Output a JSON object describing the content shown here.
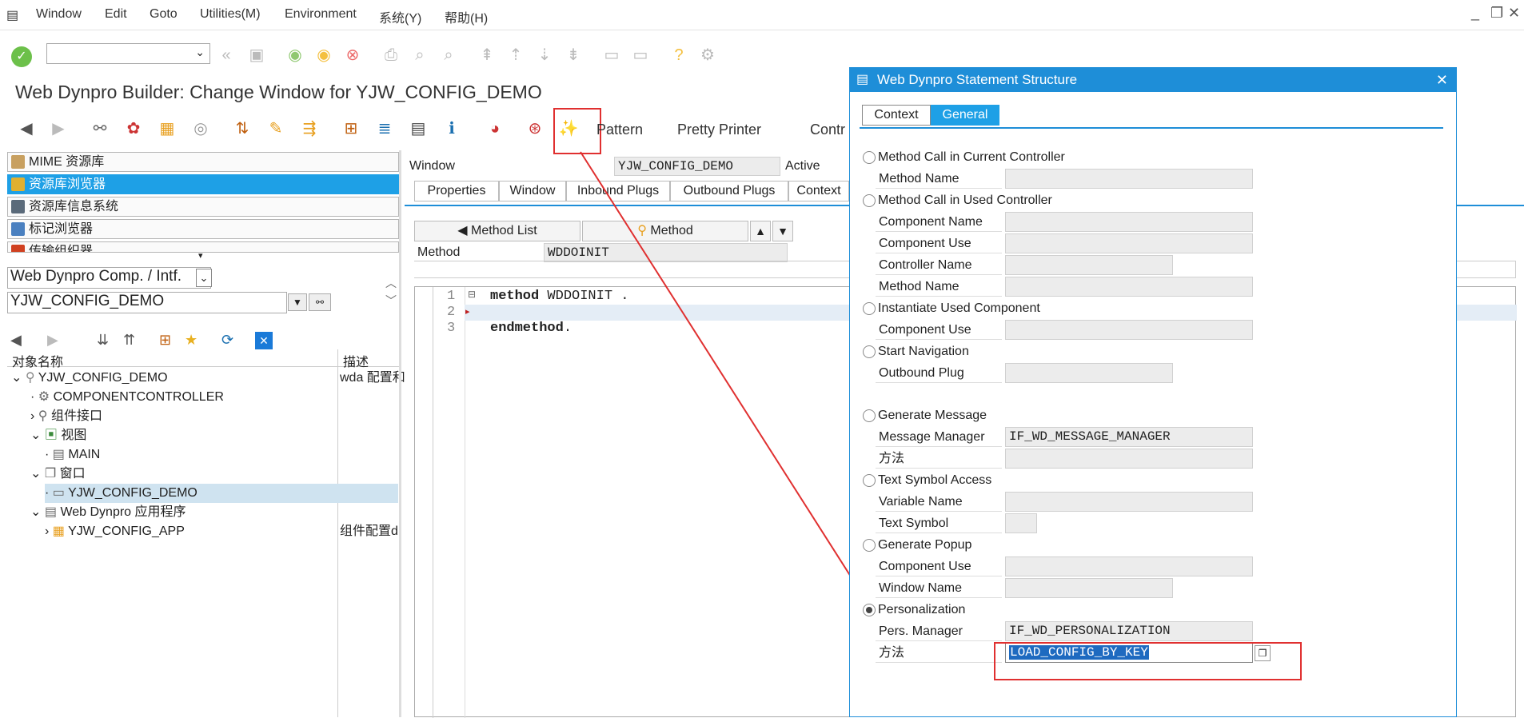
{
  "menubar": {
    "items": [
      "Window",
      "Edit",
      "Goto",
      "Utilities(M)",
      "Environment",
      "系统(Y)",
      "帮助(H)"
    ]
  },
  "title": "Web Dynpro Builder: Change Window for YJW_CONFIG_DEMO",
  "toolbar2": {
    "pattern": "Pattern",
    "pretty_printer": "Pretty Printer",
    "contr": "Contr"
  },
  "left": {
    "items": [
      "MIME 资源库",
      "资源库浏览器",
      "资源库信息系统",
      "标记浏览器",
      "传输组织器"
    ],
    "object_type": "Web Dynpro Comp. / Intf.",
    "object_name": "YJW_CONFIG_DEMO",
    "col_name": "对象名称",
    "col_desc": "描述",
    "tree": [
      {
        "label": "YJW_CONFIG_DEMO",
        "desc": "wda 配置和"
      },
      {
        "label": "COMPONENTCONTROLLER",
        "desc": ""
      },
      {
        "label": "组件接口",
        "desc": ""
      },
      {
        "label": "视图",
        "desc": ""
      },
      {
        "label": "MAIN",
        "desc": ""
      },
      {
        "label": "窗口",
        "desc": ""
      },
      {
        "label": "YJW_CONFIG_DEMO",
        "desc": ""
      },
      {
        "label": "Web Dynpro 应用程序",
        "desc": ""
      },
      {
        "label": "YJW_CONFIG_APP",
        "desc": "组件配置d"
      }
    ]
  },
  "window_header": {
    "window_label": "Window",
    "window_value": "YJW_CONFIG_DEMO",
    "status": "Active"
  },
  "tabs": [
    "Properties",
    "Window",
    "Inbound Plugs",
    "Outbound Plugs",
    "Context"
  ],
  "method_bar": {
    "method_list": "Method List",
    "method": "Method",
    "method_label": "Method",
    "method_value": "WDDOINIT"
  },
  "code": {
    "line_numbers": [
      "1",
      "2",
      "3"
    ],
    "line1_kw": "method",
    "line1_rest": " WDDOINIT .",
    "line3_kw": "endmethod",
    "line3_rest": "."
  },
  "dialog": {
    "title": "Web Dynpro Statement Structure",
    "tabs": [
      "Context",
      "General"
    ],
    "options": [
      {
        "label": "Method Call in Current Controller",
        "fields": [
          {
            "label": "Method Name",
            "value": ""
          }
        ]
      },
      {
        "label": "Method Call in Used Controller",
        "fields": [
          {
            "label": "Component Name",
            "value": ""
          },
          {
            "label": "Component Use",
            "value": ""
          },
          {
            "label": "Controller Name",
            "value": ""
          },
          {
            "label": "Method Name",
            "value": ""
          }
        ]
      },
      {
        "label": "Instantiate Used Component",
        "fields": [
          {
            "label": "Component Use",
            "value": ""
          }
        ]
      },
      {
        "label": "Start Navigation",
        "fields": [
          {
            "label": "Outbound Plug",
            "value": ""
          }
        ]
      },
      {
        "label": "Generate Message",
        "fields": [
          {
            "label": "Message Manager",
            "value": "IF_WD_MESSAGE_MANAGER"
          },
          {
            "label": "方法",
            "value": ""
          }
        ]
      },
      {
        "label": "Text Symbol Access",
        "fields": [
          {
            "label": "Variable Name",
            "value": ""
          },
          {
            "label": "Text Symbol",
            "value": ""
          }
        ]
      },
      {
        "label": "Generate Popup",
        "fields": [
          {
            "label": "Component Use",
            "value": ""
          },
          {
            "label": "Window Name",
            "value": ""
          }
        ]
      },
      {
        "label": "Personalization",
        "fields": [
          {
            "label": "Pers. Manager",
            "value": "IF_WD_PERSONALIZATION"
          },
          {
            "label": "方法",
            "value": "LOAD_CONFIG_BY_KEY"
          }
        ]
      }
    ],
    "selected_option": "Personalization"
  },
  "colors": {
    "accent": "#1e8ed8",
    "highlight": "#e03030",
    "selection": "#1ea0e6"
  }
}
